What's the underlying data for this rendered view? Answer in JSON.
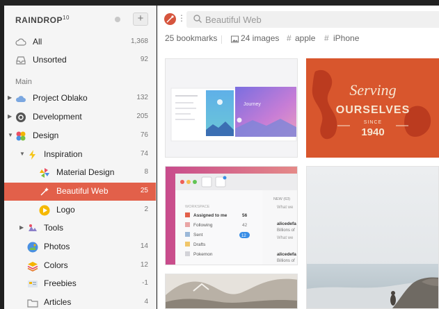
{
  "app": {
    "brand": "RAINDROP",
    "version": "10"
  },
  "sidebar": {
    "all": {
      "label": "All",
      "count": "1,368"
    },
    "unsorted": {
      "label": "Unsorted",
      "count": "92"
    },
    "section": "Main",
    "items": [
      {
        "label": "Project Oblako",
        "count": "132"
      },
      {
        "label": "Development",
        "count": "205"
      },
      {
        "label": "Design",
        "count": "76"
      },
      {
        "label": "Inspiration",
        "count": "74"
      },
      {
        "label": "Material Design",
        "count": "8"
      },
      {
        "label": "Beautiful Web",
        "count": "25"
      },
      {
        "label": "Logo",
        "count": "2"
      },
      {
        "label": "Tools",
        "count": ""
      },
      {
        "label": "Photos",
        "count": "14"
      },
      {
        "label": "Colors",
        "count": "12"
      },
      {
        "label": "Freebies",
        "count": "-1"
      },
      {
        "label": "Articles",
        "count": "4"
      }
    ]
  },
  "search": {
    "placeholder": "Beautiful Web"
  },
  "toolbar": {
    "bookmarks": "25 bookmarks",
    "images": "24 images",
    "tag1": "apple",
    "tag2": "iPhone"
  },
  "cards": {
    "card1": {
      "tile1": "Journey"
    },
    "card2": {
      "line1": "Serving",
      "line2": "OURSELVES",
      "line3": "SINCE",
      "line4": "1940"
    },
    "card3": {
      "workspace": "WORKSPACE",
      "new_count": "NEW (63)",
      "what_we": "What we",
      "items": [
        {
          "label": "Assigned to me",
          "count": "56"
        },
        {
          "label": "Following",
          "count": "42"
        },
        {
          "label": "Sent",
          "count": "12"
        },
        {
          "label": "Drafts",
          "count": ""
        },
        {
          "label": "Pokemon",
          "count": ""
        }
      ],
      "msgs": [
        {
          "name": "alicedefa",
          "text": "Billions of"
        },
        {
          "name": "alicedefa",
          "text": "Billions of"
        }
      ],
      "what_we2": "What we"
    }
  },
  "colors": {
    "accent": "#e2604a",
    "sidebar_bg": "#f5f5f5"
  }
}
